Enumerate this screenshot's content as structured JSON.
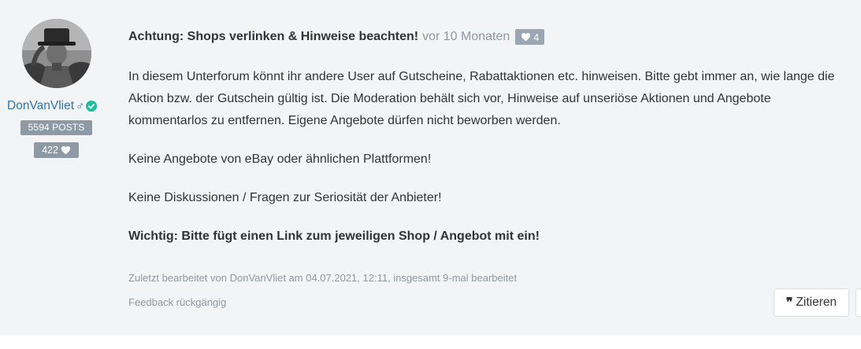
{
  "author": {
    "name": "DonVanVliet",
    "gender_symbol": "♂",
    "posts_label": "5594 POSTS",
    "likes_count": "422"
  },
  "post": {
    "title": "Achtung: Shops verlinken & Hinweise beachten!",
    "time": "vor 10 Monaten",
    "likes": "4",
    "paragraphs": [
      "In diesem Unterforum könnt ihr andere User auf Gutscheine, Rabattaktionen etc. hinweisen. Bitte gebt immer an, wie lange die Aktion bzw. der Gutschein gültig ist. Die Moderation behält sich vor, Hinweise auf unseriöse Aktionen und Angebote kommentarlos zu entfernen. Eigene Angebote dürfen nicht beworben werden.",
      "Keine Angebote von eBay oder ähnlichen Plattformen!",
      "Keine Diskussionen / Fragen zur Seriosität der Anbieter!",
      "Wichtig: Bitte fügt einen Link zum jeweiligen Shop / Angebot mit ein!"
    ],
    "edited_note": "Zuletzt bearbeitet von DonVanVliet am 04.07.2021, 12:11, insgesamt 9-mal bearbeitet",
    "feedback_link": "Feedback rückgängig"
  },
  "actions": {
    "quote_label": "Zitieren"
  },
  "colors": {
    "accent": "#2f74b1",
    "badge": "#8d9aa6",
    "verified": "#1bbf9c",
    "muted": "#8f97a0"
  },
  "icons": [
    "heart-icon",
    "verified-check-icon",
    "quote-icon"
  ]
}
